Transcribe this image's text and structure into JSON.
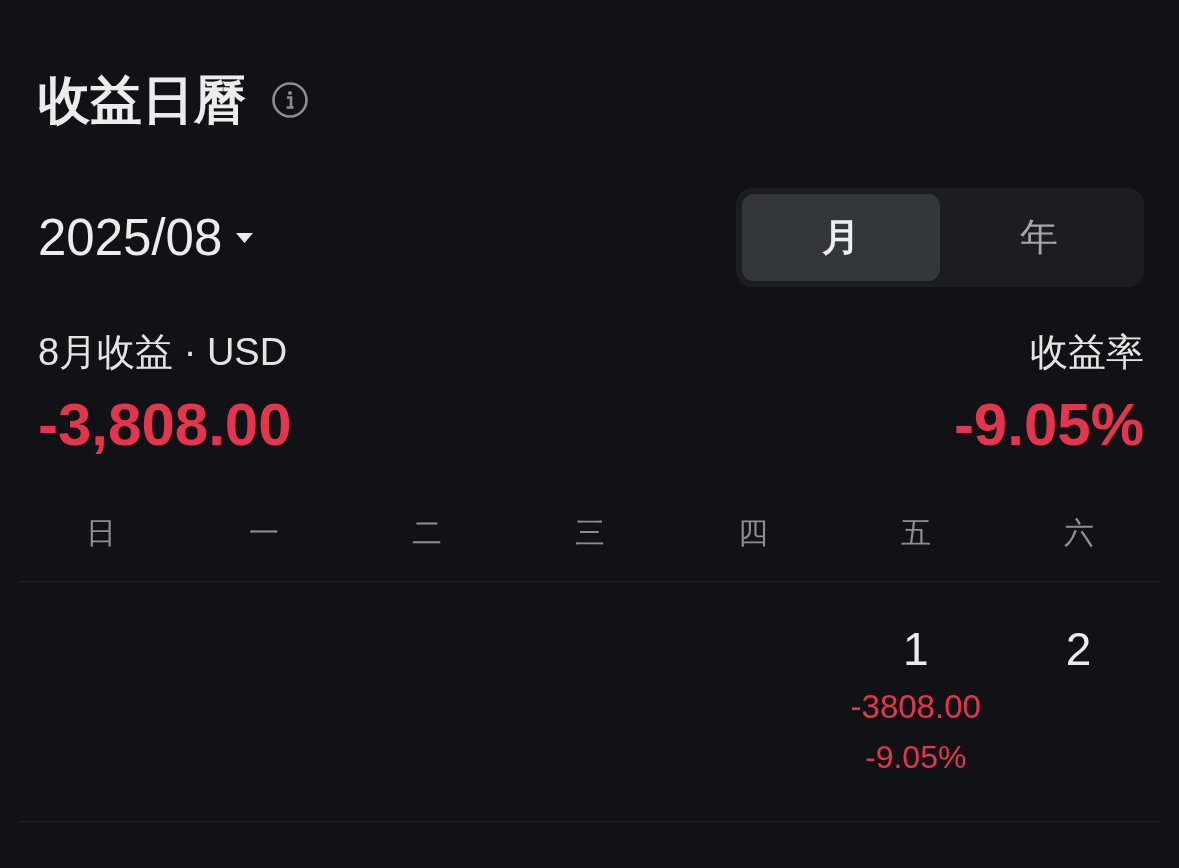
{
  "header": {
    "title": "收益日曆"
  },
  "period": {
    "value": "2025/08"
  },
  "range_tabs": [
    {
      "label": "月",
      "selected": true
    },
    {
      "label": "年",
      "selected": false
    }
  ],
  "summary": {
    "label": "8月收益 · USD",
    "amount": "-3,808.00",
    "rate_label": "收益率",
    "rate": "-9.05%"
  },
  "weekdays": [
    "日",
    "一",
    "二",
    "三",
    "四",
    "五",
    "六"
  ],
  "weeks": [
    {
      "cells": [
        {
          "kind": "empty"
        },
        {
          "kind": "empty"
        },
        {
          "kind": "empty"
        },
        {
          "kind": "empty"
        },
        {
          "kind": "empty"
        },
        {
          "kind": "day",
          "date": "1",
          "pnl": "-3808.00",
          "rate": "-9.05%"
        },
        {
          "kind": "day",
          "date": "2"
        }
      ]
    }
  ]
}
